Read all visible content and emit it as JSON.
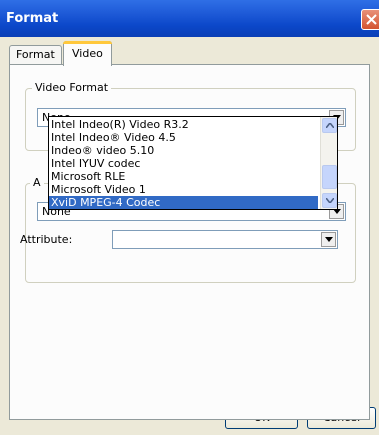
{
  "window": {
    "title": "Format"
  },
  "tabs": [
    {
      "label": "Format",
      "active": false
    },
    {
      "label": "Video",
      "active": true
    }
  ],
  "video_format": {
    "legend": "Video Format",
    "selected_value": "None",
    "options": [
      "Intel Indeo(R) Video R3.2",
      "Intel Indeo® Video 4.5",
      "Indeo® video 5.10",
      "Intel IYUV codec",
      "Microsoft RLE",
      "Microsoft Video 1",
      "XviD MPEG-4 Codec"
    ],
    "highlighted_option": "XviD MPEG-4 Codec"
  },
  "second_group": {
    "legend_partial": "A",
    "selected_value": "None",
    "attribute_label": "Attribute:",
    "attribute_value": ""
  },
  "buttons": {
    "ok": "OK",
    "cancel": "Cancel"
  },
  "colors": {
    "titlebar": "#0b47c9",
    "close_button": "#d3532f",
    "selection": "#316ac5",
    "dialog_bg": "#ece9d8"
  }
}
